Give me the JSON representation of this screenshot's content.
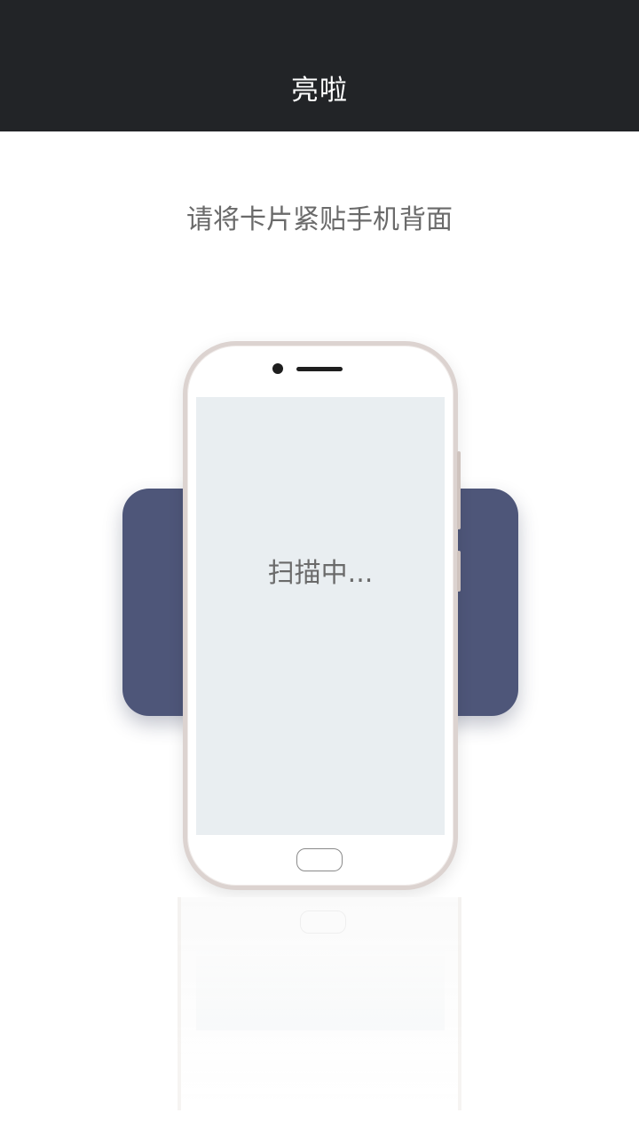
{
  "header": {
    "title": "亮啦"
  },
  "instruction": {
    "text": "请将卡片紧贴手机背面"
  },
  "phone": {
    "screen_text": "扫描中..."
  },
  "colors": {
    "header_bg": "#222427",
    "card": "#4e5679",
    "screen_bg": "#e9eef1",
    "text_gray": "#6a6a6a"
  }
}
